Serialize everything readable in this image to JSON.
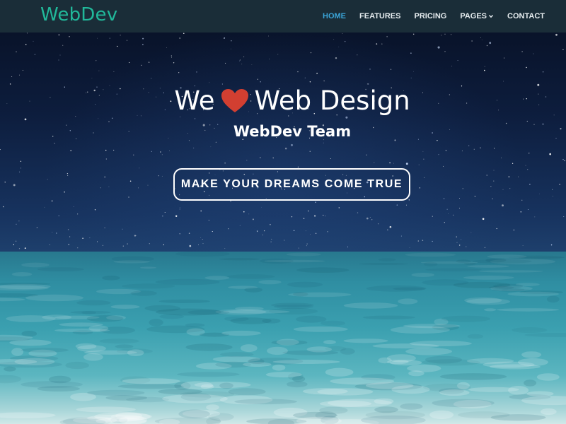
{
  "navbar": {
    "brand": "WebDev",
    "items": [
      {
        "label": "HOME",
        "active": true
      },
      {
        "label": "FEATURES",
        "active": false
      },
      {
        "label": "PRICING",
        "active": false
      },
      {
        "label": "PAGES",
        "active": false,
        "dropdown": true
      },
      {
        "label": "CONTACT",
        "active": false
      }
    ]
  },
  "hero": {
    "title_before": "We",
    "title_icon": "heart-icon",
    "title_after": "Web Design",
    "subtitle": "WebDev Team",
    "cta_label": "MAKE YOUR DREAMS COME TRUE"
  },
  "colors": {
    "navbar_bg": "#1a2d38",
    "brand": "#21b89a",
    "nav_active": "#3aa3d6",
    "heart": "#d23f31"
  }
}
